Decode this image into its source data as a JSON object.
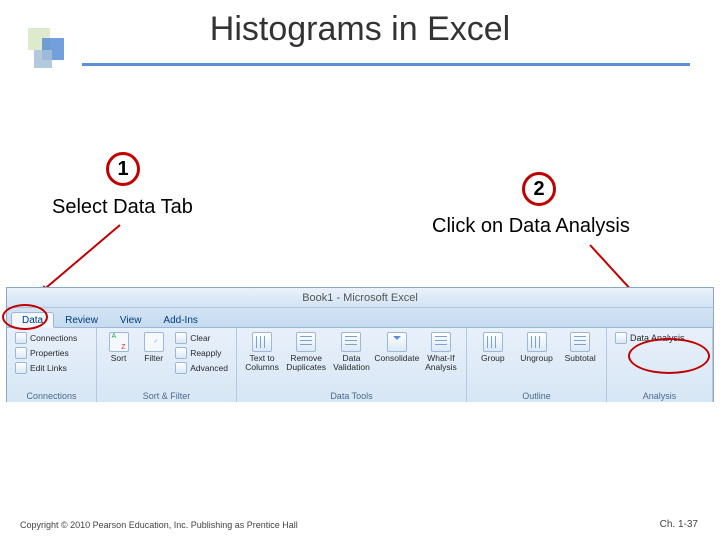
{
  "title": "Histograms in Excel",
  "steps": [
    {
      "num": "1",
      "label": "Select Data Tab"
    },
    {
      "num": "2",
      "label": "Click on Data Analysis"
    }
  ],
  "ribbon": {
    "window_title": "Book1 - Microsoft Excel",
    "tabs": [
      "Data",
      "Review",
      "View",
      "Add-Ins"
    ],
    "active_tab": "Data",
    "connections": {
      "conn": "Connections",
      "prop": "Properties",
      "edit": "Edit Links",
      "gname": "Connections"
    },
    "sortfilter": {
      "sort": "Sort",
      "filter": "Filter",
      "clear": "Clear",
      "reapply": "Reapply",
      "advanced": "Advanced",
      "gname": "Sort & Filter"
    },
    "datatools": {
      "ttc": "Text to\nColumns",
      "rmdup": "Remove\nDuplicates",
      "dval": "Data\nValidation",
      "cons": "Consolidate",
      "whatif": "What-If\nAnalysis",
      "gname": "Data Tools"
    },
    "outline": {
      "group": "Group",
      "ungroup": "Ungroup",
      "subtotal": "Subtotal",
      "gname": "Outline"
    },
    "analysis": {
      "da": "Data Analysis",
      "gname": "Analysis"
    }
  },
  "footer": "Copyright © 2010 Pearson Education, Inc. Publishing as Prentice Hall",
  "pagenum": "Ch. 1-37"
}
